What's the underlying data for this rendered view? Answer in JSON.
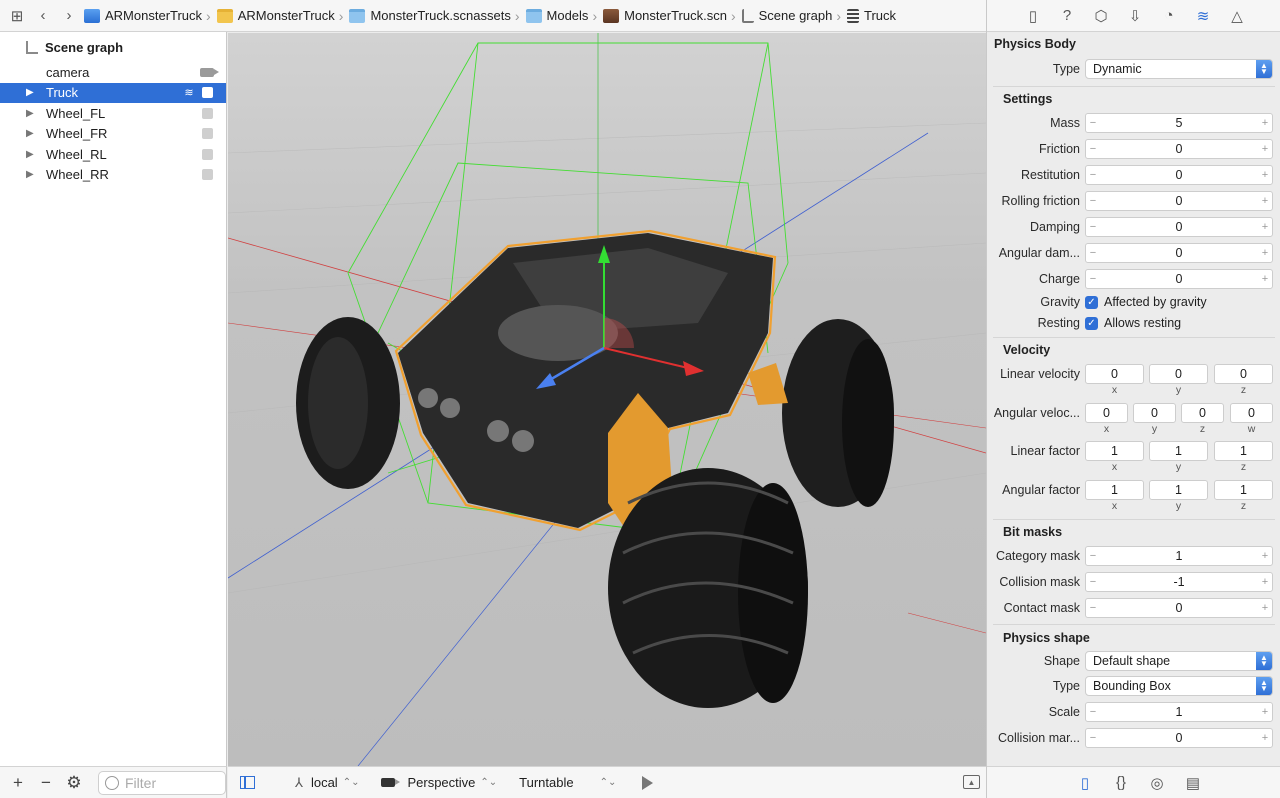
{
  "pathbar": {
    "crumbs": [
      "ARMonsterTruck",
      "ARMonsterTruck",
      "MonsterTruck.scnassets",
      "Models",
      "MonsterTruck.scn",
      "Scene graph",
      "Truck"
    ]
  },
  "sidebar": {
    "header": "Scene graph",
    "nodes": [
      {
        "label": "camera"
      },
      {
        "label": "Truck"
      },
      {
        "label": "Wheel_FL"
      },
      {
        "label": "Wheel_FR"
      },
      {
        "label": "Wheel_RL"
      },
      {
        "label": "Wheel_RR"
      }
    ],
    "filter_placeholder": "Filter"
  },
  "viewport_bar": {
    "space": "local",
    "camera": "Perspective",
    "mode": "Turntable"
  },
  "inspector": {
    "physics_body": {
      "title": "Physics Body",
      "type_label": "Type",
      "type_value": "Dynamic"
    },
    "settings": {
      "title": "Settings",
      "mass_label": "Mass",
      "mass": "5",
      "friction_label": "Friction",
      "friction": "0",
      "restitution_label": "Restitution",
      "restitution": "0",
      "rolling_label": "Rolling friction",
      "rolling": "0",
      "damping_label": "Damping",
      "damping": "0",
      "angular_damping_label": "Angular dam...",
      "angular_damping": "0",
      "charge_label": "Charge",
      "charge": "0",
      "gravity_label": "Gravity",
      "gravity_text": "Affected by gravity",
      "resting_label": "Resting",
      "resting_text": "Allows resting"
    },
    "velocity": {
      "title": "Velocity",
      "linear_velocity_label": "Linear velocity",
      "linear_velocity": [
        "0",
        "0",
        "0"
      ],
      "angular_velocity_label": "Angular veloc...",
      "angular_velocity": [
        "0",
        "0",
        "0",
        "0"
      ],
      "linear_factor_label": "Linear factor",
      "linear_factor": [
        "1",
        "1",
        "1"
      ],
      "angular_factor_label": "Angular factor",
      "angular_factor": [
        "1",
        "1",
        "1"
      ],
      "axes3": [
        "x",
        "y",
        "z"
      ],
      "axes4": [
        "x",
        "y",
        "z",
        "w"
      ]
    },
    "bitmasks": {
      "title": "Bit masks",
      "category_label": "Category mask",
      "category": "1",
      "collision_label": "Collision mask",
      "collision": "-1",
      "contact_label": "Contact mask",
      "contact": "0"
    },
    "physics_shape": {
      "title": "Physics shape",
      "shape_label": "Shape",
      "shape_value": "Default shape",
      "type_label": "Type",
      "type_value": "Bounding Box",
      "scale_label": "Scale",
      "scale": "1",
      "collision_margin_label": "Collision mar...",
      "collision_margin": "0"
    }
  },
  "colors": {
    "accent": "#2f6fd6",
    "selection_outline": "#f0a030",
    "bounds_green": "#44dd33"
  }
}
